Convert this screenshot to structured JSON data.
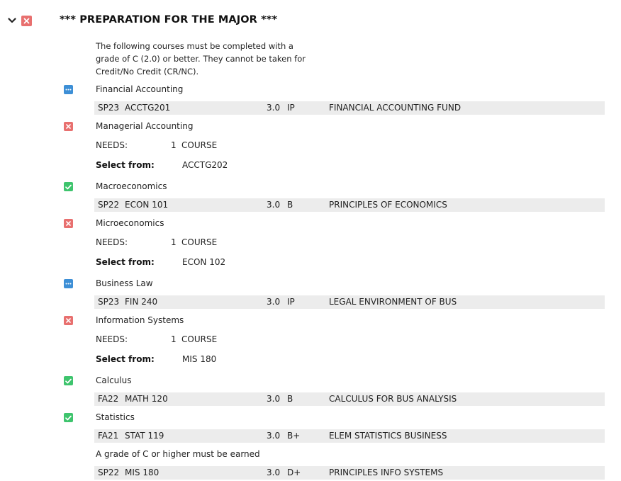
{
  "header": {
    "title": "*** PREPARATION FOR THE MAJOR ***",
    "status": "not-complete",
    "colors": {
      "fail": "#e8706f",
      "ok": "#3ec46d",
      "in_progress": "#3d8fd6",
      "row_bg": "#ececec"
    }
  },
  "description": "The following courses must be completed with a grade of C (2.0) or better. They cannot be taken for Credit/No Credit (CR/NC).",
  "requirements": [
    {
      "label": "Financial Accounting",
      "status": "in-progress",
      "course": {
        "term": "SP23",
        "course": "ACCTG201",
        "credits": "3.0",
        "grade": "IP",
        "title": "FINANCIAL ACCOUNTING FUND"
      }
    },
    {
      "label": "Managerial Accounting",
      "status": "not-complete",
      "needs": {
        "label": "NEEDS:",
        "count": "1",
        "unit": "COURSE"
      },
      "select_from": {
        "label": "Select from:",
        "courses": "ACCTG202"
      }
    },
    {
      "label": "Macroeconomics",
      "status": "complete",
      "course": {
        "term": "SP22",
        "course": "ECON 101",
        "credits": "3.0",
        "grade": "B",
        "title": "PRINCIPLES OF ECONOMICS"
      }
    },
    {
      "label": "Microeconomics",
      "status": "not-complete",
      "needs": {
        "label": "NEEDS:",
        "count": "1",
        "unit": "COURSE"
      },
      "select_from": {
        "label": "Select from:",
        "courses": "ECON 102"
      }
    },
    {
      "label": "Business Law",
      "status": "in-progress",
      "course": {
        "term": "SP23",
        "course": "FIN 240",
        "credits": "3.0",
        "grade": "IP",
        "title": "LEGAL ENVIRONMENT OF BUS"
      }
    },
    {
      "label": "Information Systems",
      "status": "not-complete",
      "needs": {
        "label": "NEEDS:",
        "count": "1",
        "unit": "COURSE"
      },
      "select_from": {
        "label": "Select from:",
        "courses": "MIS 180"
      }
    },
    {
      "label": "Calculus",
      "status": "complete",
      "course": {
        "term": "FA22",
        "course": "MATH 120",
        "credits": "3.0",
        "grade": "B",
        "title": "CALCULUS FOR BUS ANALYSIS"
      }
    },
    {
      "label": "Statistics",
      "status": "complete",
      "course": {
        "term": "FA21",
        "course": "STAT 119",
        "credits": "3.0",
        "grade": "B+",
        "title": "ELEM STATISTICS BUSINESS"
      },
      "note": "A grade of C or higher must be earned",
      "course2": {
        "term": "SP22",
        "course": "MIS 180",
        "credits": "3.0",
        "grade": "D+",
        "title": "PRINCIPLES INFO SYSTEMS"
      }
    }
  ]
}
